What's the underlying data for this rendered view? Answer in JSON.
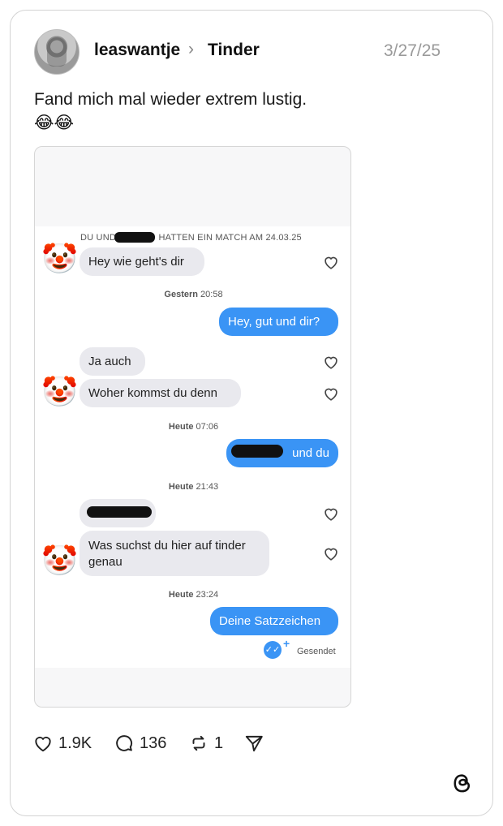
{
  "post": {
    "username": "leaswantje",
    "separator": "›",
    "community": "Tinder",
    "date": "3/27/25",
    "caption": "Fand mich mal wieder extrem lustig.",
    "emojis": "😂😂"
  },
  "screenshot": {
    "match_prefix": "DU UND",
    "match_suffix": "HATTEN EIN MATCH AM 24.03.25",
    "clown_emoji": "🤡",
    "messages": [
      {
        "text": "Hey wie geht's dir",
        "direction": "incoming"
      },
      {
        "time_label": "Gestern",
        "time": "20:58"
      },
      {
        "text": "Hey, gut und dir?",
        "direction": "outgoing"
      },
      {
        "text": "Ja auch",
        "direction": "incoming"
      },
      {
        "text": "Woher kommst du denn",
        "direction": "incoming"
      },
      {
        "time_label": "Heute",
        "time": "07:06"
      },
      {
        "text": "und du",
        "direction": "outgoing",
        "partially_redacted": true
      },
      {
        "time_label": "Heute",
        "time": "21:43"
      },
      {
        "text": "",
        "direction": "incoming",
        "redacted": true
      },
      {
        "text": "Was suchst du hier auf tinder genau",
        "direction": "incoming"
      },
      {
        "time_label": "Heute",
        "time": "23:24"
      },
      {
        "text": "Deine Satzzeichen",
        "direction": "outgoing"
      }
    ],
    "status": "Gesendet",
    "status_icon": "double-check-icon"
  },
  "actions": {
    "likes": "1.9K",
    "comments": "136",
    "reposts": "1"
  },
  "colors": {
    "outgoing_bubble": "#3a94f5",
    "incoming_bubble": "#e9e9ee",
    "date_text": "#9a9a9a"
  }
}
